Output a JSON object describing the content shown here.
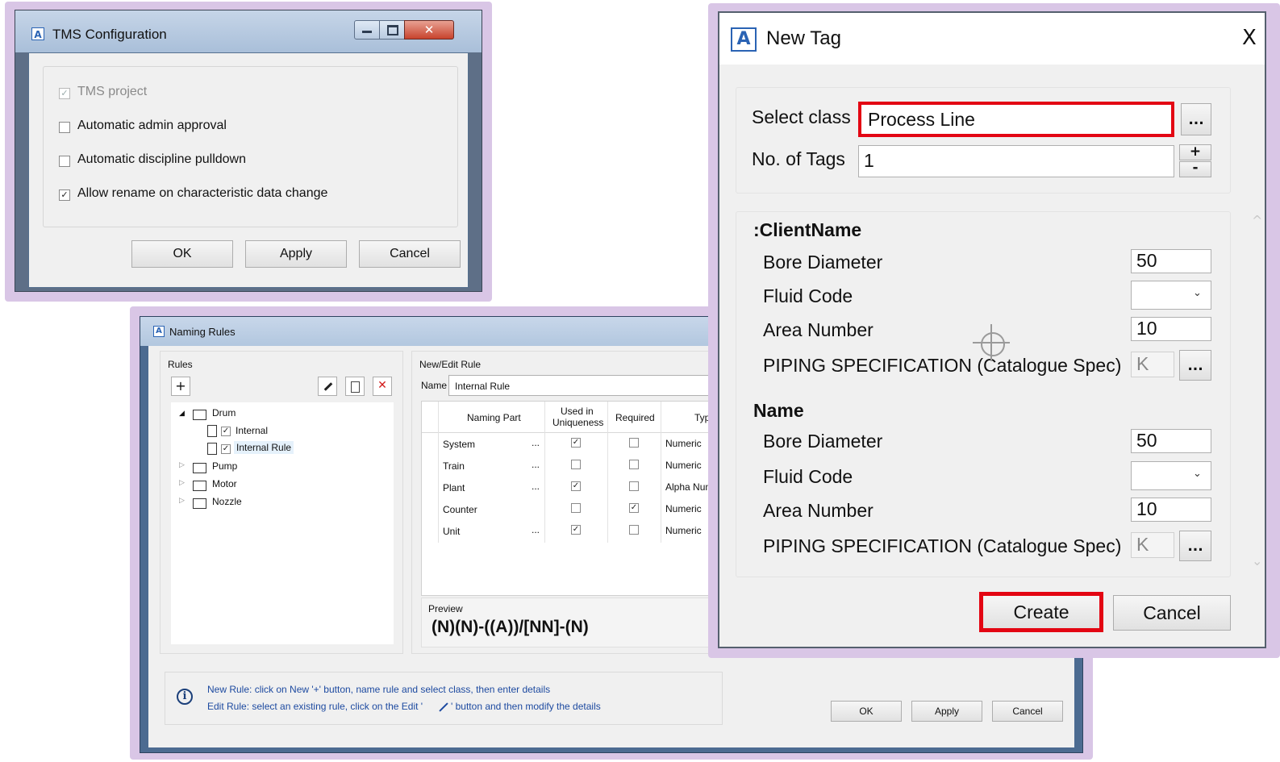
{
  "tms": {
    "title": "TMS Configuration",
    "options": [
      {
        "label": "TMS project",
        "checked": true,
        "disabled": true
      },
      {
        "label": "Automatic admin approval",
        "checked": false,
        "disabled": false
      },
      {
        "label": "Automatic discipline pulldown",
        "checked": false,
        "disabled": false
      },
      {
        "label": "Allow rename on characteristic data change",
        "checked": true,
        "disabled": false
      }
    ],
    "ok": "OK",
    "apply": "Apply",
    "cancel": "Cancel"
  },
  "naming": {
    "title": "Naming Rules",
    "rules_label": "Rules",
    "add_label": "+",
    "tree": {
      "drum": "Drum",
      "internal": "Internal",
      "internal_rule": "Internal Rule",
      "pump": "Pump",
      "motor": "Motor",
      "nozzle": "Nozzle"
    },
    "edit_label": "New/Edit Rule",
    "name_label": "Name",
    "name_value": "Internal Rule",
    "columns": [
      "Naming Part",
      "Used in Uniqueness",
      "Required",
      "Type"
    ],
    "col_used": "Used in",
    "col_uniq": "Uniqueness",
    "rows": [
      {
        "part": "System",
        "dots": "...",
        "used": true,
        "required": false,
        "type": "Numeric"
      },
      {
        "part": "Train",
        "dots": "...",
        "used": false,
        "required": false,
        "type": "Numeric"
      },
      {
        "part": "Plant",
        "dots": "...",
        "used": true,
        "required": false,
        "type": "Alpha Numeri"
      },
      {
        "part": "Counter",
        "dots": "",
        "used": false,
        "required": true,
        "type": "Numeric"
      },
      {
        "part": "Unit",
        "dots": "...",
        "used": true,
        "required": false,
        "type": "Numeric"
      }
    ],
    "preview_label": "Preview",
    "preview_value": "(N)(N)-((A))/[NN]-(N)",
    "info_line1": "New Rule: click on New '+' button, name rule and select class, then enter details",
    "info_line2a": "Edit Rule: select an existing rule, click on the Edit '",
    "info_line2b": "' button and then modify the details",
    "ok": "OK",
    "apply": "Apply",
    "cancel": "Cancel"
  },
  "newtag": {
    "title": "New Tag",
    "close": "X",
    "select_class_label": "Select class",
    "select_class_value": "Process Line",
    "browse": "...",
    "tags_label": "No. of Tags",
    "tags_value": "1",
    "plus": "+",
    "minus": "-",
    "section1": ":ClientName",
    "section2": "Name",
    "bore_label": "Bore Diameter",
    "bore_value": "50",
    "fluid_label": "Fluid Code",
    "area_label": "Area Number",
    "area_value": "10",
    "piping_label": "PIPING SPECIFICATION (Catalogue Spec)",
    "piping_value": "K",
    "create": "Create",
    "cancel": "Cancel"
  },
  "colors": {
    "highlight": "#e30613",
    "accent": "#2a63b4"
  }
}
